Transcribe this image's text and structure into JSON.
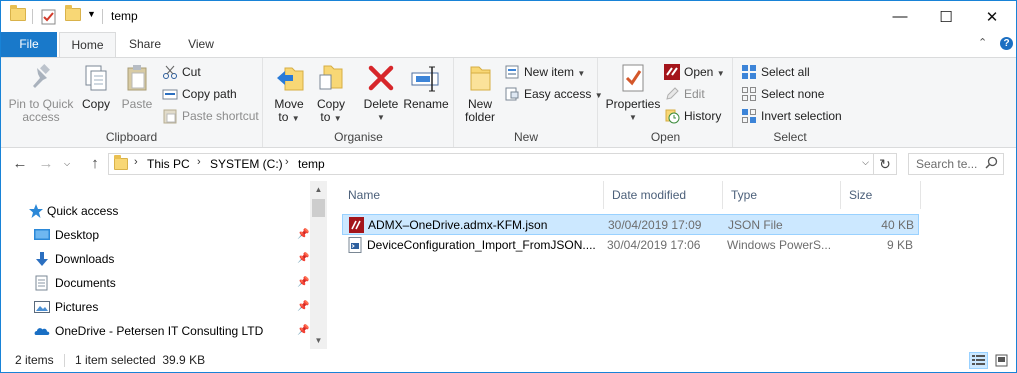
{
  "window": {
    "title": "temp",
    "controls": {
      "minimize": "—",
      "maximize": "☐",
      "close": "✕"
    }
  },
  "ribbon": {
    "tabs": [
      {
        "label": "File"
      },
      {
        "label": "Home"
      },
      {
        "label": "Share"
      },
      {
        "label": "View"
      }
    ],
    "help": "?",
    "collapse": "⌃",
    "groups": {
      "clipboard": {
        "label": "Clipboard",
        "pin": "Pin to Quick\naccess",
        "pin_line1": "Pin to Quick",
        "pin_line2": "access",
        "copy": "Copy",
        "paste": "Paste",
        "cut": "Cut",
        "copy_path": "Copy path",
        "paste_shortcut": "Paste shortcut"
      },
      "organise": {
        "label": "Organise",
        "move_to_1": "Move",
        "move_to_2": "to",
        "copy_to_1": "Copy",
        "copy_to_2": "to",
        "delete": "Delete",
        "rename": "Rename"
      },
      "new": {
        "label": "New",
        "new_folder_1": "New",
        "new_folder_2": "folder",
        "new_item": "New item",
        "easy_access": "Easy access"
      },
      "open": {
        "label": "Open",
        "properties": "Properties",
        "open": "Open",
        "edit": "Edit",
        "history": "History"
      },
      "select": {
        "label": "Select",
        "select_all": "Select all",
        "select_none": "Select none",
        "invert_selection": "Invert selection"
      }
    }
  },
  "address": {
    "crumbs": [
      "This PC",
      "SYSTEM (C:)",
      "temp"
    ],
    "search_placeholder": "Search te..."
  },
  "nav": {
    "items": [
      {
        "label": "Quick access",
        "icon": "star-icon"
      },
      {
        "label": "Desktop",
        "icon": "desktop-icon"
      },
      {
        "label": "Downloads",
        "icon": "download-icon"
      },
      {
        "label": "Documents",
        "icon": "documents-icon"
      },
      {
        "label": "Pictures",
        "icon": "pictures-icon"
      },
      {
        "label": "OneDrive - Petersen IT Consulting LTD",
        "icon": "onedrive-icon"
      }
    ]
  },
  "files": {
    "columns": {
      "name": "Name",
      "date": "Date modified",
      "type": "Type",
      "size": "Size"
    },
    "rows": [
      {
        "name": "ADMX–OneDrive.admx-KFM.json",
        "date": "30/04/2019 17:09",
        "type": "JSON File",
        "size": "40 KB",
        "selected": true,
        "icon": "json-file-icon"
      },
      {
        "name": "DeviceConfiguration_Import_FromJSON....",
        "date": "30/04/2019 17:06",
        "type": "Windows PowerS...",
        "size": "9 KB",
        "selected": false,
        "icon": "powershell-file-icon"
      }
    ]
  },
  "status": {
    "item_count": "2 items",
    "selection": "1 item selected  39.9 KB"
  },
  "colors": {
    "accent": "#1979ca",
    "selection_bg": "#cce8ff",
    "selection_border": "#99d1ff",
    "ribbon_bg": "#f5f6f7",
    "delete_red": "#d7262a"
  }
}
